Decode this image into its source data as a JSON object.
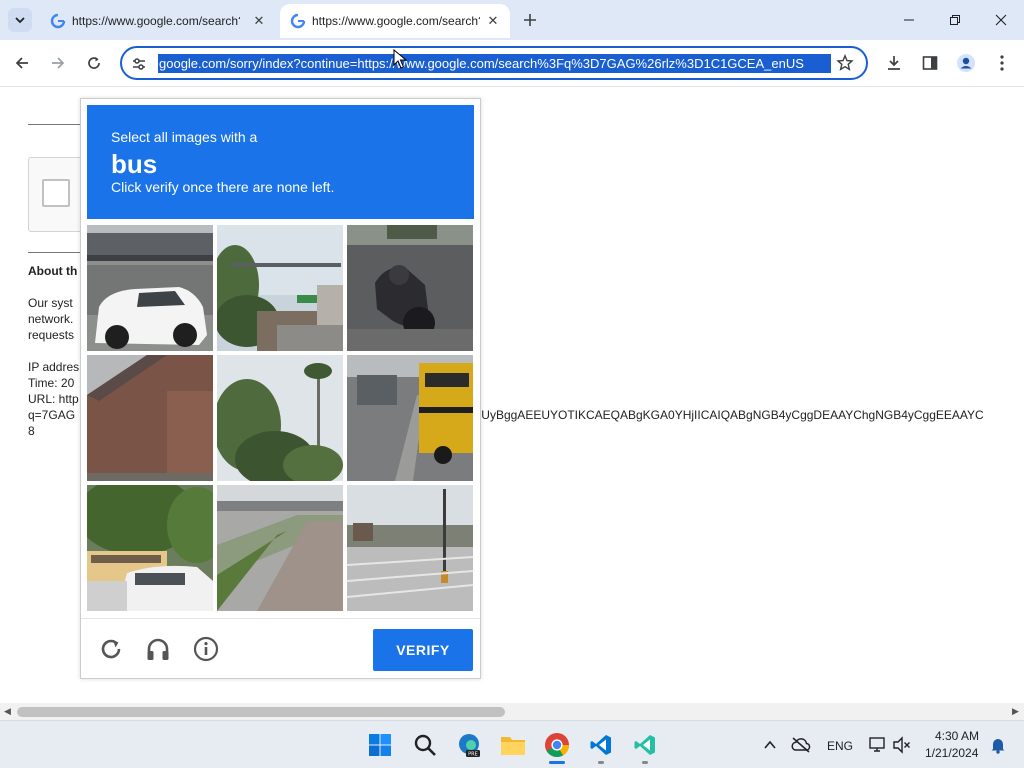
{
  "browser": {
    "tabs": [
      {
        "title": "https://www.google.com/search?q",
        "active": false
      },
      {
        "title": "https://www.google.com/search?q",
        "active": true
      }
    ],
    "url": "google.com/sorry/index?continue=https://www.google.com/search%3Fq%3D7GAG%26rlz%3D1C1GCEA_enUS",
    "accent": "#1a5fd1"
  },
  "page": {
    "about_heading": "About th",
    "lines": [
      "Our syst",
      "network.",
      "requests"
    ],
    "ip_label": "IP addres",
    "time_label": "Time: 20",
    "url_label": "URL: http",
    "query_prefix": "q=7GAG",
    "query_tail": "'UyBggAEEUYOTIKCAEQABgKGA0YHjIICAIQABgNGB4yCggDEAAYChgNGB4yCggEEAAYC",
    "last_line": "8"
  },
  "captcha": {
    "line1": "Select all images with a",
    "target": "bus",
    "line2": "Click verify once there are none left.",
    "verify_label": "VERIFY",
    "header_color": "#1a73e8"
  },
  "taskbar": {
    "language": "ENG",
    "time": "4:30 AM",
    "date": "1/21/2024",
    "apps": [
      "start",
      "search",
      "edge-preview",
      "file-explorer",
      "chrome",
      "vscode",
      "vscode-insiders"
    ]
  }
}
